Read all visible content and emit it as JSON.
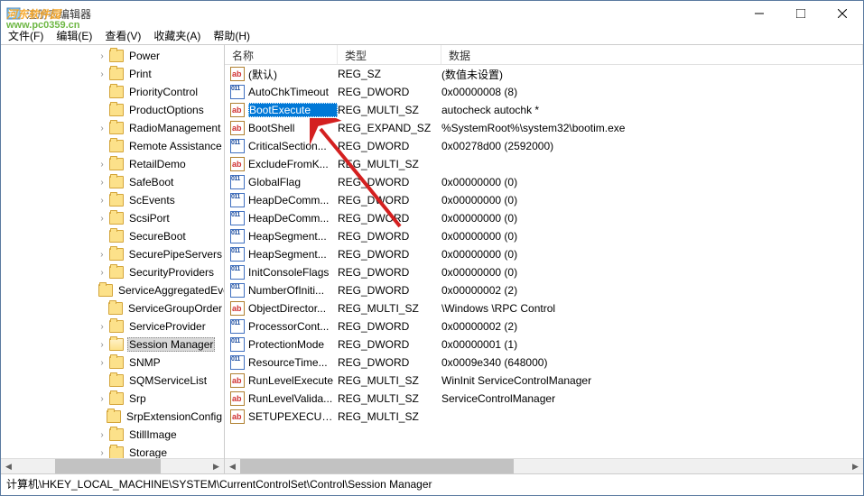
{
  "window": {
    "title": "注册表编辑器"
  },
  "menu": {
    "file": "文件(F)",
    "edit": "编辑(E)",
    "view": "查看(V)",
    "favorites": "收藏夹(A)",
    "help": "帮助(H)"
  },
  "watermark": {
    "line1": "河东软件园",
    "line2": "www.pc0359.cn"
  },
  "tree": {
    "items": [
      {
        "label": "Power",
        "indent": 106,
        "arrow": ">"
      },
      {
        "label": "Print",
        "indent": 106,
        "arrow": ">"
      },
      {
        "label": "PriorityControl",
        "indent": 106,
        "arrow": ""
      },
      {
        "label": "ProductOptions",
        "indent": 106,
        "arrow": ""
      },
      {
        "label": "RadioManagement",
        "indent": 106,
        "arrow": ">"
      },
      {
        "label": "Remote Assistance",
        "indent": 106,
        "arrow": ""
      },
      {
        "label": "RetailDemo",
        "indent": 106,
        "arrow": ">"
      },
      {
        "label": "SafeBoot",
        "indent": 106,
        "arrow": ">"
      },
      {
        "label": "ScEvents",
        "indent": 106,
        "arrow": ">"
      },
      {
        "label": "ScsiPort",
        "indent": 106,
        "arrow": ">"
      },
      {
        "label": "SecureBoot",
        "indent": 106,
        "arrow": ""
      },
      {
        "label": "SecurePipeServers",
        "indent": 106,
        "arrow": ">"
      },
      {
        "label": "SecurityProviders",
        "indent": 106,
        "arrow": ">"
      },
      {
        "label": "ServiceAggregatedEvents",
        "indent": 106,
        "arrow": ""
      },
      {
        "label": "ServiceGroupOrder",
        "indent": 106,
        "arrow": ""
      },
      {
        "label": "ServiceProvider",
        "indent": 106,
        "arrow": ">"
      },
      {
        "label": "Session Manager",
        "indent": 106,
        "arrow": ">",
        "selected": true
      },
      {
        "label": "SNMP",
        "indent": 106,
        "arrow": ">"
      },
      {
        "label": "SQMServiceList",
        "indent": 106,
        "arrow": ""
      },
      {
        "label": "Srp",
        "indent": 106,
        "arrow": ">"
      },
      {
        "label": "SrpExtensionConfig",
        "indent": 106,
        "arrow": ""
      },
      {
        "label": "StillImage",
        "indent": 106,
        "arrow": ">"
      },
      {
        "label": "Storage",
        "indent": 106,
        "arrow": ">"
      }
    ]
  },
  "list": {
    "headers": {
      "name": "名称",
      "type": "类型",
      "data": "数据"
    },
    "rows": [
      {
        "icon": "str",
        "name": "(默认)",
        "type": "REG_SZ",
        "data": "(数值未设置)"
      },
      {
        "icon": "bin",
        "name": "AutoChkTimeout",
        "type": "REG_DWORD",
        "data": "0x00000008 (8)"
      },
      {
        "icon": "str",
        "name": "BootExecute",
        "type": "REG_MULTI_SZ",
        "data": "autocheck autochk *",
        "selected": true
      },
      {
        "icon": "str",
        "name": "BootShell",
        "type": "REG_EXPAND_SZ",
        "data": "%SystemRoot%\\system32\\bootim.exe"
      },
      {
        "icon": "bin",
        "name": "CriticalSection...",
        "type": "REG_DWORD",
        "data": "0x00278d00 (2592000)"
      },
      {
        "icon": "str",
        "name": "ExcludeFromK...",
        "type": "REG_MULTI_SZ",
        "data": ""
      },
      {
        "icon": "bin",
        "name": "GlobalFlag",
        "type": "REG_DWORD",
        "data": "0x00000000 (0)"
      },
      {
        "icon": "bin",
        "name": "HeapDeComm...",
        "type": "REG_DWORD",
        "data": "0x00000000 (0)"
      },
      {
        "icon": "bin",
        "name": "HeapDeComm...",
        "type": "REG_DWORD",
        "data": "0x00000000 (0)"
      },
      {
        "icon": "bin",
        "name": "HeapSegment...",
        "type": "REG_DWORD",
        "data": "0x00000000 (0)"
      },
      {
        "icon": "bin",
        "name": "HeapSegment...",
        "type": "REG_DWORD",
        "data": "0x00000000 (0)"
      },
      {
        "icon": "bin",
        "name": "InitConsoleFlags",
        "type": "REG_DWORD",
        "data": "0x00000000 (0)"
      },
      {
        "icon": "bin",
        "name": "NumberOfIniti...",
        "type": "REG_DWORD",
        "data": "0x00000002 (2)"
      },
      {
        "icon": "str",
        "name": "ObjectDirector...",
        "type": "REG_MULTI_SZ",
        "data": "\\Windows \\RPC Control"
      },
      {
        "icon": "bin",
        "name": "ProcessorCont...",
        "type": "REG_DWORD",
        "data": "0x00000002 (2)"
      },
      {
        "icon": "bin",
        "name": "ProtectionMode",
        "type": "REG_DWORD",
        "data": "0x00000001 (1)"
      },
      {
        "icon": "bin",
        "name": "ResourceTime...",
        "type": "REG_DWORD",
        "data": "0x0009e340 (648000)"
      },
      {
        "icon": "str",
        "name": "RunLevelExecute",
        "type": "REG_MULTI_SZ",
        "data": "WinInit ServiceControlManager"
      },
      {
        "icon": "str",
        "name": "RunLevelValida...",
        "type": "REG_MULTI_SZ",
        "data": "ServiceControlManager"
      },
      {
        "icon": "str",
        "name": "SETUPEXECUTE",
        "type": "REG_MULTI_SZ",
        "data": ""
      }
    ]
  },
  "statusbar": {
    "path": "计算机\\HKEY_LOCAL_MACHINE\\SYSTEM\\CurrentControlSet\\Control\\Session Manager"
  }
}
